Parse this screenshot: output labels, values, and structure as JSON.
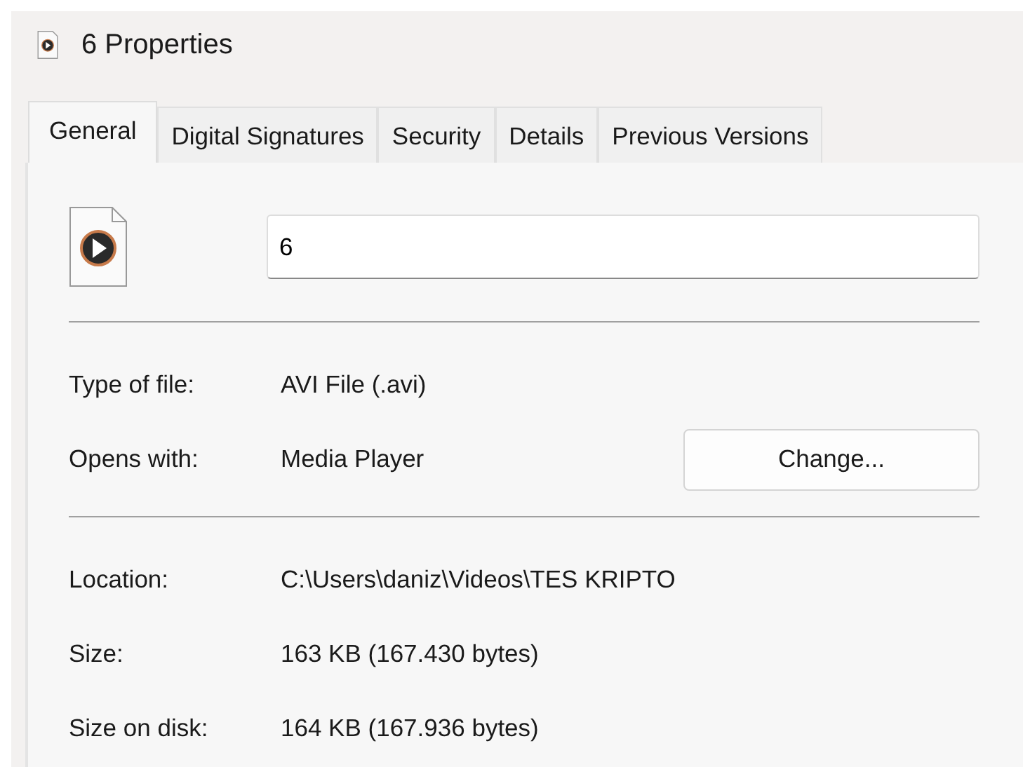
{
  "window": {
    "title": "6 Properties"
  },
  "tabs": [
    {
      "label": "General",
      "selected": true
    },
    {
      "label": "Digital Signatures",
      "selected": false
    },
    {
      "label": "Security",
      "selected": false
    },
    {
      "label": "Details",
      "selected": false
    },
    {
      "label": "Previous Versions",
      "selected": false
    }
  ],
  "name_field": {
    "value": "6"
  },
  "type_rows": [
    {
      "label": "Type of file:",
      "value": "AVI File (.avi)"
    },
    {
      "label": "Opens with:",
      "value": "Media Player",
      "button": "Change..."
    }
  ],
  "size_rows": [
    {
      "label": "Location:",
      "value": "C:\\Users\\daniz\\Videos\\TES KRIPTO"
    },
    {
      "label": "Size:",
      "value": "163 KB (167.430 bytes)"
    },
    {
      "label": "Size on disk:",
      "value": "164 KB (167.936 bytes)"
    }
  ]
}
